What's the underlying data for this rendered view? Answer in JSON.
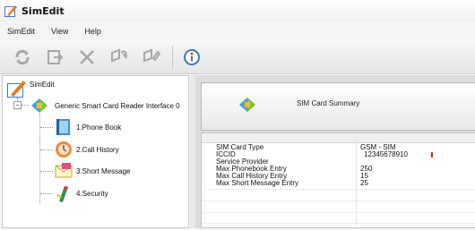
{
  "window": {
    "title": "SimEdit"
  },
  "menu": [
    "SimEdit",
    "View",
    "Help"
  ],
  "toolbar": {
    "buttons": [
      "refresh-icon",
      "export-icon",
      "delete-icon",
      "read-card-icon",
      "write-card-icon",
      "info-icon"
    ]
  },
  "tree": {
    "root": "SimEdit",
    "reader": "Generic Smart Card Reader Interface 0",
    "items": [
      {
        "label": "1.Phone Book",
        "icon": "phone-book-icon"
      },
      {
        "label": "2.Call History",
        "icon": "call-history-icon"
      },
      {
        "label": "3.Short Message",
        "icon": "short-message-icon"
      },
      {
        "label": "4.Security",
        "icon": "security-icon"
      }
    ]
  },
  "summary": {
    "title": "SIM Card Summary",
    "rows": [
      {
        "key": "SIM Card Type",
        "value": "GSM - SIM"
      },
      {
        "key": "ICCID",
        "value": "12345678910"
      },
      {
        "key": "Service Provider",
        "value": ""
      },
      {
        "key": "Max Phonebook Entry",
        "value": "250"
      },
      {
        "key": "Max Call History Entry",
        "value": "15"
      },
      {
        "key": "Max Short Message Entry",
        "value": "25"
      }
    ]
  }
}
